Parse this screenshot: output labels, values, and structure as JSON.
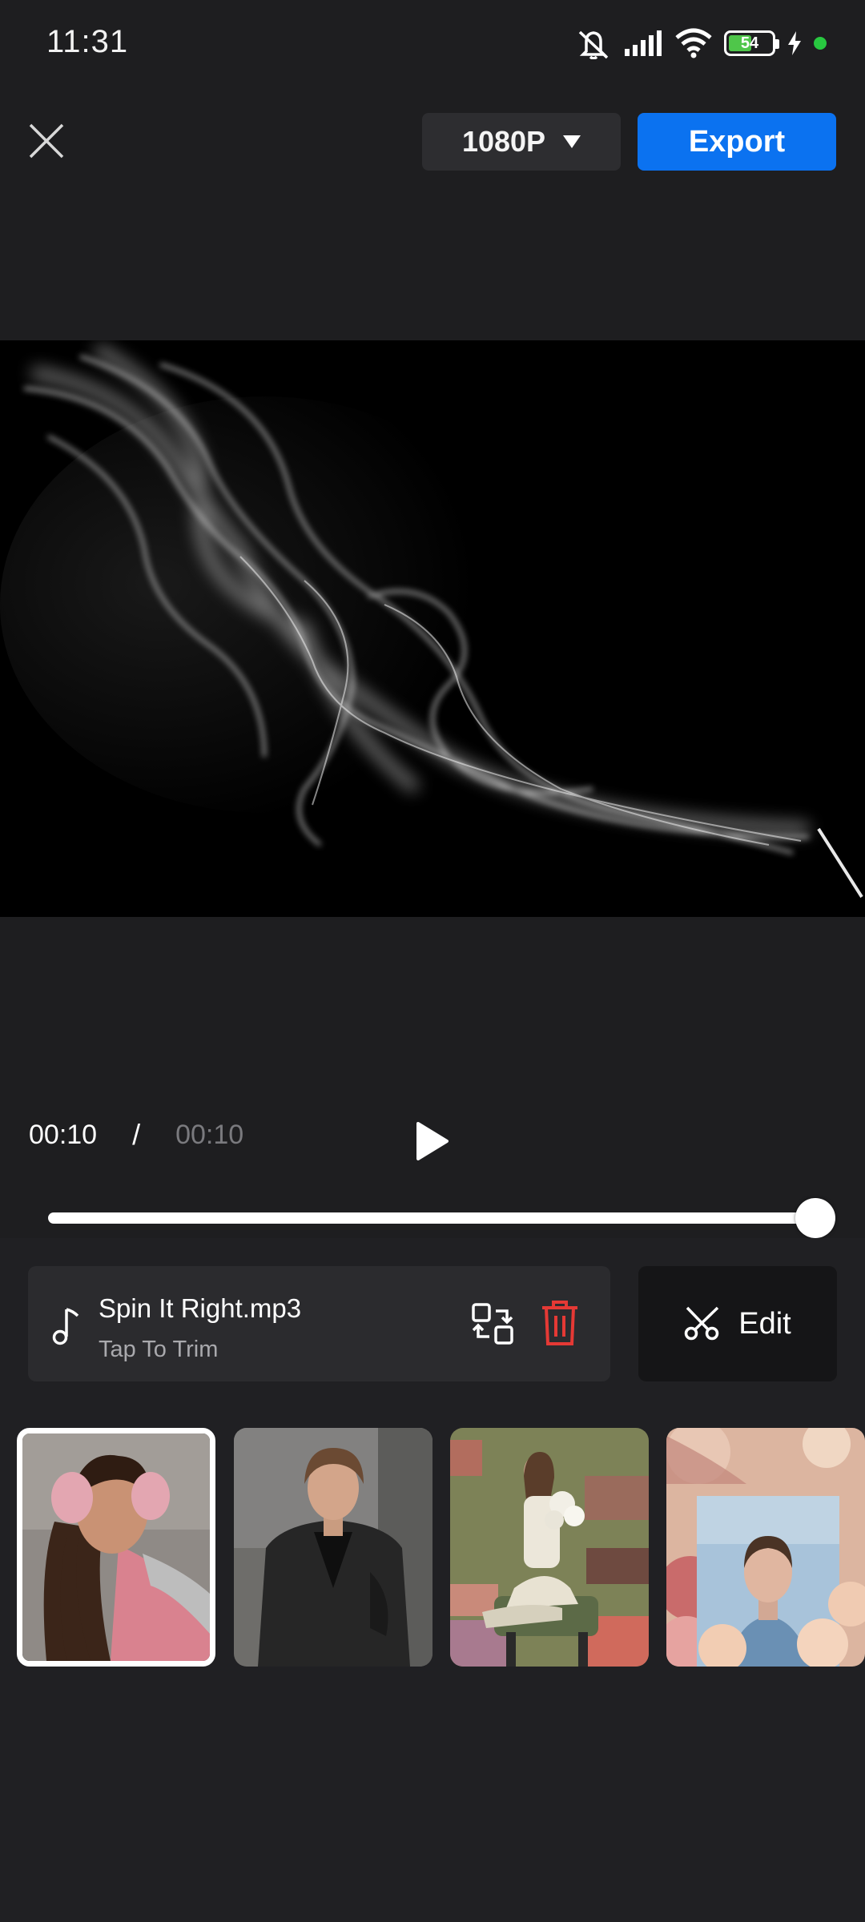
{
  "status_bar": {
    "time": "11:31",
    "battery_level": "54",
    "icons": [
      "mute-icon",
      "signal-icon",
      "wifi-icon",
      "battery-icon",
      "charging-icon"
    ]
  },
  "top_bar": {
    "close_icon": "close-icon",
    "resolution_label": "1080P",
    "export_label": "Export",
    "accent_color": "#0b72f0"
  },
  "playback": {
    "current_time": "00:10",
    "separator": "/",
    "total_time": "00:10",
    "progress": 1.0
  },
  "music": {
    "file_name": "Spin It Right.mp3",
    "hint": "Tap To Trim",
    "delete_color": "#e53935"
  },
  "edit": {
    "label": "Edit"
  },
  "templates": {
    "selected_index": 0,
    "items": [
      "template-1",
      "template-2",
      "template-3",
      "template-4"
    ]
  }
}
